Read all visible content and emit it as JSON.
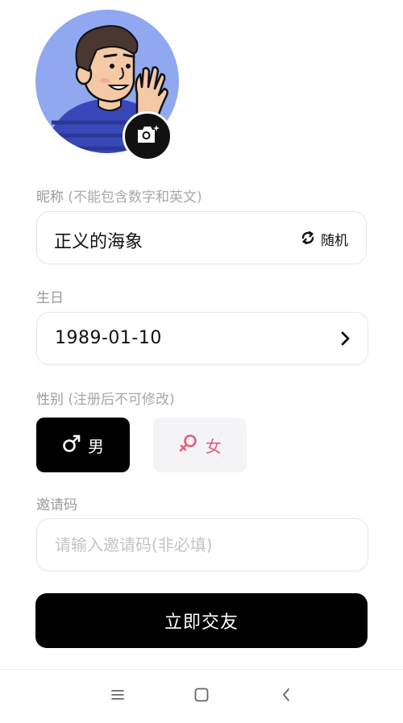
{
  "nickname": {
    "label": "昵称",
    "hint": "(不能包含数字和英文)",
    "value": "正义的海象",
    "random_label": "随机"
  },
  "birthday": {
    "label": "生日",
    "value": "1989-01-10"
  },
  "gender": {
    "label": "性别",
    "hint": "(注册后不可修改)",
    "male_label": "男",
    "female_label": "女",
    "selected": "male"
  },
  "invite": {
    "label": "邀请码",
    "placeholder": "请输入邀请码(非必填)",
    "value": ""
  },
  "submit_label": "立即交友",
  "icons": {
    "camera": "camera-icon",
    "refresh": "refresh-icon",
    "chevron": "chevron-right-icon",
    "male": "male-symbol-icon",
    "female": "female-symbol-icon",
    "nav_menu": "menu-icon",
    "nav_home": "home-square-icon",
    "nav_back": "back-icon"
  },
  "colors": {
    "primary": "#000000",
    "female_accent": "#e35f78",
    "avatar_bg": "#8fa8ef",
    "label": "#9a9a9a"
  }
}
